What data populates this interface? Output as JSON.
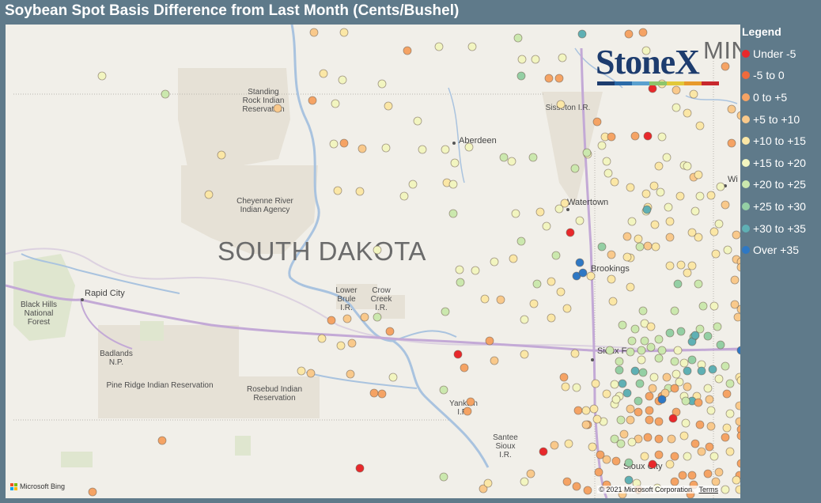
{
  "title": "Soybean Spot Basis Difference from Last Month (Cents/Bushel)",
  "map": {
    "state_label": "SOUTH DAKOTA",
    "partial_state_label": "MIN",
    "places": [
      {
        "id": "standing-rock",
        "text": "Standing\nRock Indian\nReservation"
      },
      {
        "id": "cheyenne-river",
        "text": "Cheyenne River\nIndian Agency"
      },
      {
        "id": "black-hills",
        "text": "Black Hills\nNational\nForest"
      },
      {
        "id": "badlands",
        "text": "Badlands\nN.P."
      },
      {
        "id": "pine-ridge",
        "text": "Pine Ridge Indian Reservation"
      },
      {
        "id": "rosebud",
        "text": "Rosebud Indian\nReservation"
      },
      {
        "id": "lower-brule",
        "text": "Lower\nBrule\nI.R."
      },
      {
        "id": "crow-creek",
        "text": "Crow\nCreek\nI.R."
      },
      {
        "id": "sisseton",
        "text": "Sisseton I.R."
      },
      {
        "id": "yankton",
        "text": "Yankton\nI.R."
      },
      {
        "id": "santee",
        "text": "Santee\nSioux\nI.R."
      }
    ],
    "cities": [
      {
        "id": "aberdeen",
        "text": "Aberdeen"
      },
      {
        "id": "watertown",
        "text": "Watertown"
      },
      {
        "id": "brookings",
        "text": "Brookings"
      },
      {
        "id": "rapid-city",
        "text": "Rapid City"
      },
      {
        "id": "sioux-falls",
        "text": "Sioux F"
      },
      {
        "id": "sioux-city",
        "text": "Sioux City"
      },
      {
        "id": "wi",
        "text": "Wi"
      }
    ],
    "attribution": {
      "bing": "Microsoft Bing",
      "copyright": "© 2021 Microsoft Corporation",
      "terms": "Terms"
    }
  },
  "logo": {
    "text": "StoneX",
    "bar_colors": [
      "#1d3c6e",
      "#2b6aa8",
      "#5aa0cf",
      "#8dc56b",
      "#e2c83a",
      "#e89a2c",
      "#c8282d"
    ]
  },
  "legend": {
    "title": "Legend",
    "items": [
      {
        "label": "Under -5",
        "color": "#e8282b"
      },
      {
        "label": "-5 to 0",
        "color": "#ef6a3c"
      },
      {
        "label": "0 to +5",
        "color": "#f5a364"
      },
      {
        "label": "+5 to +10",
        "color": "#f9c98b"
      },
      {
        "label": "+10 to +15",
        "color": "#fbe7a6"
      },
      {
        "label": "+15 to +20",
        "color": "#f2f5c0"
      },
      {
        "label": "+20 to +25",
        "color": "#cbe8ae"
      },
      {
        "label": "+25 to +30",
        "color": "#94cfa4"
      },
      {
        "label": "+30 to +35",
        "color": "#5fb0b4"
      },
      {
        "label": "Over +35",
        "color": "#2e78c4"
      }
    ]
  }
}
